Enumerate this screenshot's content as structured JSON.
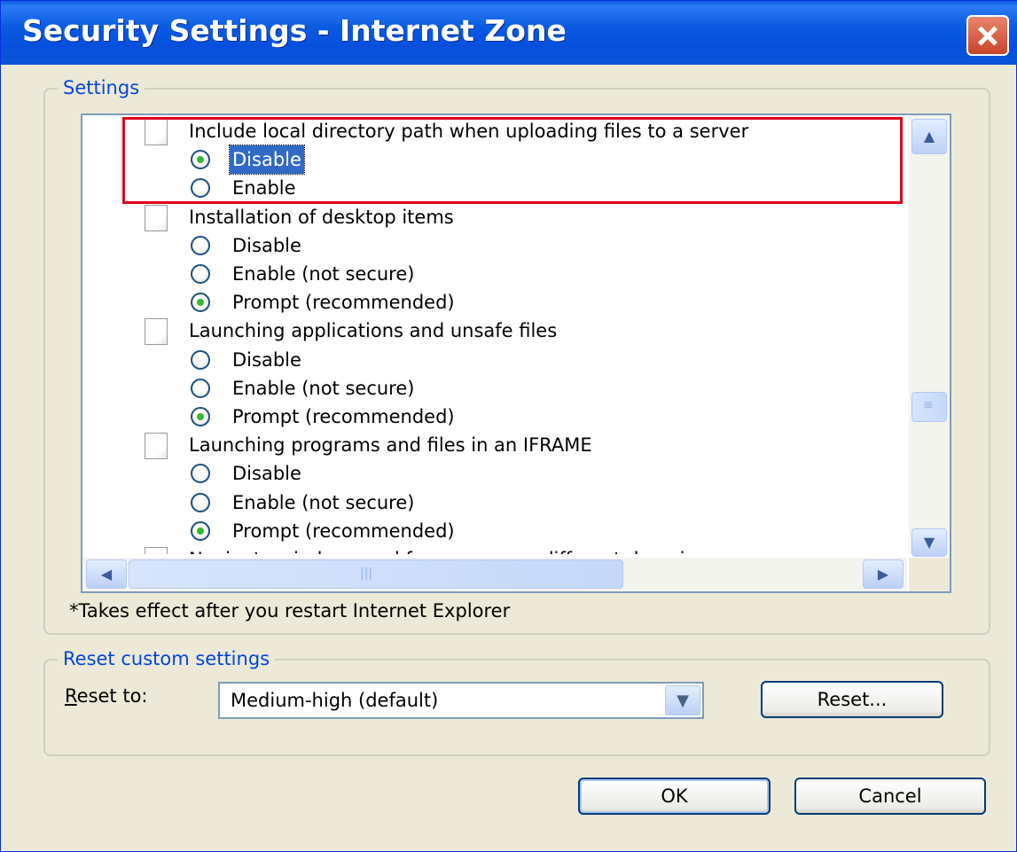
{
  "window": {
    "title": "Security Settings - Internet Zone",
    "close_label": "✕"
  },
  "settings_group": {
    "title": "Settings",
    "sections": [
      {
        "label": "Include local directory path when uploading files to a server",
        "options": [
          {
            "label": "Disable",
            "checked": true
          },
          {
            "label": "Enable",
            "checked": false
          }
        ]
      },
      {
        "label": "Installation of desktop items",
        "options": [
          {
            "label": "Disable",
            "checked": false
          },
          {
            "label": "Enable (not secure)",
            "checked": false
          },
          {
            "label": "Prompt (recommended)",
            "checked": true
          }
        ]
      },
      {
        "label": "Launching applications and unsafe files",
        "options": [
          {
            "label": "Disable",
            "checked": false
          },
          {
            "label": "Enable (not secure)",
            "checked": false
          },
          {
            "label": "Prompt (recommended)",
            "checked": true
          }
        ]
      },
      {
        "label": "Launching programs and files in an IFRAME",
        "options": [
          {
            "label": "Disable",
            "checked": false
          },
          {
            "label": "Enable (not secure)",
            "checked": false
          },
          {
            "label": "Prompt (recommended)",
            "checked": true
          }
        ]
      },
      {
        "label": "Navigate windows and frames across different domains",
        "options": []
      }
    ],
    "note": "*Takes effect after you restart Internet Explorer"
  },
  "reset_group": {
    "title": "Reset custom settings",
    "reset_to_label": "eset to:",
    "reset_to_mnemonic": "R",
    "selected": "Medium-high (default)",
    "reset_button": "Reset..."
  },
  "footer": {
    "ok": "OK",
    "cancel": "Cancel"
  },
  "colors": {
    "titlebar": "#0A5AE0",
    "group_title": "#0046D5",
    "highlight": "#E2001A",
    "selection": "#316AC5"
  }
}
